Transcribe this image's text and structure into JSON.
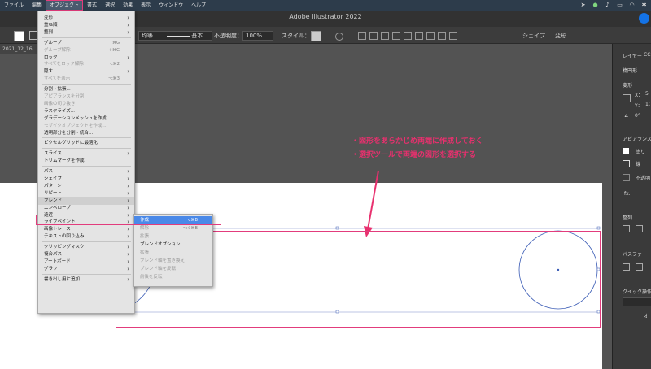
{
  "menubar": {
    "items": [
      "ファイル",
      "編集",
      "オブジェクト",
      "書式",
      "選択",
      "効果",
      "表示",
      "ウィンドウ",
      "ヘルプ"
    ],
    "active_index": 2
  },
  "app": {
    "title": "Adobe Illustrator 2022"
  },
  "controlbar": {
    "stroke_style": "均等",
    "brush": "基本",
    "opacity_label": "不透明度：",
    "opacity_value": "100%",
    "style_label": "スタイル：",
    "shape_label": "シェイプ",
    "transform_label": "変形"
  },
  "document": {
    "tab": "2021_12_16..."
  },
  "object_menu": {
    "items": [
      {
        "label": "変形",
        "submenu": true
      },
      {
        "label": "重ね順",
        "submenu": true
      },
      {
        "label": "整列",
        "submenu": true
      },
      {
        "sep": true
      },
      {
        "label": "グループ",
        "shortcut": "⌘G"
      },
      {
        "label": "グループ解除",
        "shortcut": "⇧⌘G",
        "disabled": true
      },
      {
        "label": "ロック",
        "submenu": true
      },
      {
        "label": "すべてをロック解除",
        "shortcut": "⌥⌘2",
        "disabled": true
      },
      {
        "label": "隠す",
        "submenu": true
      },
      {
        "label": "すべてを表示",
        "shortcut": "⌥⌘3",
        "disabled": true
      },
      {
        "sep": true
      },
      {
        "label": "分割・拡張..."
      },
      {
        "label": "アピアランスを分割",
        "disabled": true
      },
      {
        "label": "画像の切り抜き",
        "disabled": true
      },
      {
        "label": "ラスタライズ..."
      },
      {
        "label": "グラデーションメッシュを作成..."
      },
      {
        "label": "モザイクオブジェクトを作成...",
        "disabled": true
      },
      {
        "label": "透明部分を分割・統合..."
      },
      {
        "sep": true
      },
      {
        "label": "ピクセルグリッドに最適化"
      },
      {
        "sep": true
      },
      {
        "label": "スライス",
        "submenu": true
      },
      {
        "label": "トリムマークを作成"
      },
      {
        "sep": true
      },
      {
        "label": "パス",
        "submenu": true
      },
      {
        "label": "シェイプ",
        "submenu": true
      },
      {
        "label": "パターン",
        "submenu": true
      },
      {
        "label": "リピート",
        "submenu": true
      },
      {
        "label": "ブレンド",
        "submenu": true,
        "highlighted": true
      },
      {
        "label": "エンベロープ",
        "submenu": true
      },
      {
        "label": "遠近",
        "submenu": true
      },
      {
        "label": "ライブペイント",
        "submenu": true
      },
      {
        "label": "画像トレース",
        "submenu": true
      },
      {
        "label": "テキストの回り込み",
        "submenu": true
      },
      {
        "sep": true
      },
      {
        "label": "クリッピングマスク",
        "submenu": true
      },
      {
        "label": "複合パス",
        "submenu": true
      },
      {
        "label": "アートボード",
        "submenu": true
      },
      {
        "label": "グラフ",
        "submenu": true
      },
      {
        "sep": true
      },
      {
        "label": "書き出し用に追加",
        "submenu": true
      }
    ]
  },
  "blend_menu": {
    "items": [
      {
        "label": "作成",
        "shortcut": "⌥⌘B",
        "selected": true
      },
      {
        "label": "解除",
        "shortcut": "⌥⇧⌘B",
        "disabled": true
      },
      {
        "label": "拡張",
        "disabled": true
      },
      {
        "label": "ブレンドオプション..."
      },
      {
        "label": "拡張",
        "disabled": true
      },
      {
        "label": "ブレンド軸を置き換え",
        "disabled": true
      },
      {
        "label": "ブレンド軸を反転",
        "disabled": true
      },
      {
        "label": "前後を反転",
        "disabled": true
      }
    ]
  },
  "annotations": {
    "line1": "・図形をあらかじめ両端に作成しておく",
    "line2": "・選択ツールで両端の図形を選択する"
  },
  "right_panel": {
    "layer_tab": "レイヤー",
    "cc_tab": "CC",
    "shape_name": "楕円形",
    "transform": "変形",
    "x_label": "X：",
    "x_value": "5",
    "y_label": "Y：",
    "y_value": "1(",
    "angle_value": "0°",
    "appearance": "アピアランス",
    "fill": "塗り",
    "stroke": "線",
    "opacity": "不透明",
    "fx": "fx.",
    "align": "整列",
    "pathfinder": "パスファ",
    "quick_actions": "クイック操作",
    "quick_btn": "オ"
  },
  "colors": {
    "accent": "#e23c7c",
    "selection": "#4a89e8",
    "path": "#3a5bb5"
  }
}
